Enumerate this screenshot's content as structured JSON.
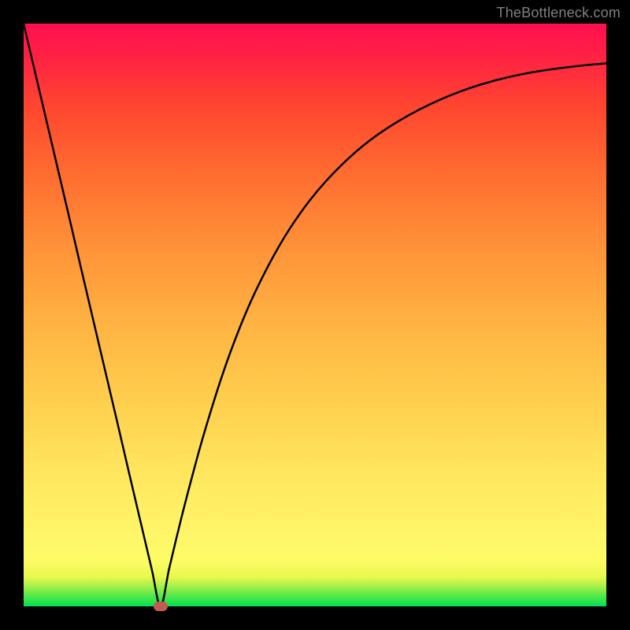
{
  "watermark": "TheBottleneck.com",
  "chart_data": {
    "type": "line",
    "title": "",
    "xlabel": "",
    "ylabel": "",
    "xlim": [
      0,
      100
    ],
    "ylim": [
      0,
      100
    ],
    "grid": false,
    "legend": false,
    "series": [
      {
        "name": "curve",
        "x": [
          0,
          2,
          4,
          6,
          8,
          10,
          12,
          14,
          16,
          18,
          20,
          22,
          23.5,
          25,
          27,
          29,
          31,
          34,
          37,
          40,
          44,
          48,
          52,
          57,
          62,
          68,
          74,
          80,
          87,
          94,
          100
        ],
        "y": [
          100,
          91.5,
          83,
          74.5,
          66,
          57.4,
          48.9,
          40.4,
          31.9,
          23.3,
          14.8,
          6.3,
          0,
          6.6,
          14.9,
          22.6,
          29.8,
          39.4,
          47.6,
          54.5,
          62.1,
          68.2,
          73.1,
          78,
          81.8,
          85.3,
          88,
          90,
          91.6,
          92.6,
          93.2
        ],
        "color": "#000000",
        "linewidth": 2.5
      }
    ],
    "marker": {
      "x": 23.5,
      "y": 0,
      "color": "#c65a52"
    }
  }
}
